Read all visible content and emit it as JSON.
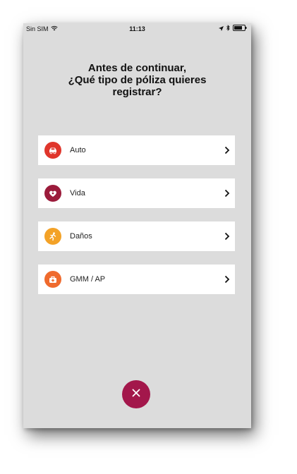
{
  "status": {
    "carrier": "Sin SIM",
    "time": "11:13"
  },
  "heading": {
    "line1": "Antes de continuar,",
    "line2": "¿Qué tipo de póliza quieres",
    "line3": "registrar?"
  },
  "options": [
    {
      "label": "Auto",
      "icon": "car-icon",
      "color": "#e0362c"
    },
    {
      "label": "Vida",
      "icon": "heart-person-icon",
      "color": "#9b1b3b"
    },
    {
      "label": "Daños",
      "icon": "running-person-icon",
      "color": "#f3a227"
    },
    {
      "label": "GMM / AP",
      "icon": "medical-bag-icon",
      "color": "#ef6a2d"
    }
  ],
  "close_button": {
    "icon": "close-icon",
    "color": "#a3174b"
  }
}
